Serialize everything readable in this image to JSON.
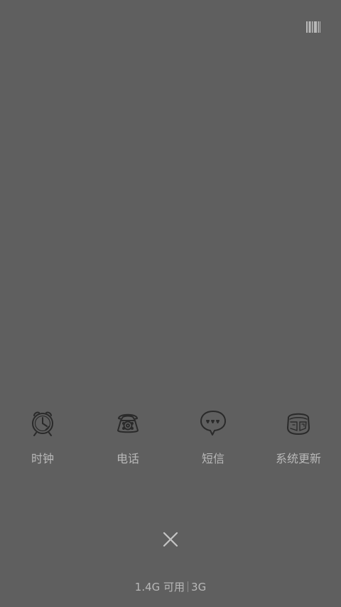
{
  "top_right": {
    "icon": "barcode-icon"
  },
  "apps": [
    {
      "label": "时钟",
      "icon": "alarm-clock-icon"
    },
    {
      "label": "电话",
      "icon": "rotary-phone-icon"
    },
    {
      "label": "短信",
      "icon": "chat-bubble-icon"
    },
    {
      "label": "系统更新",
      "icon": "update-icon"
    }
  ],
  "close": {
    "icon": "close-icon"
  },
  "memory": {
    "available": "1.4G 可用",
    "network": "3G"
  },
  "colors": {
    "background": "#5f5f5f",
    "text": "#b8b8b8",
    "icon_stroke": "#2a2a2a"
  }
}
